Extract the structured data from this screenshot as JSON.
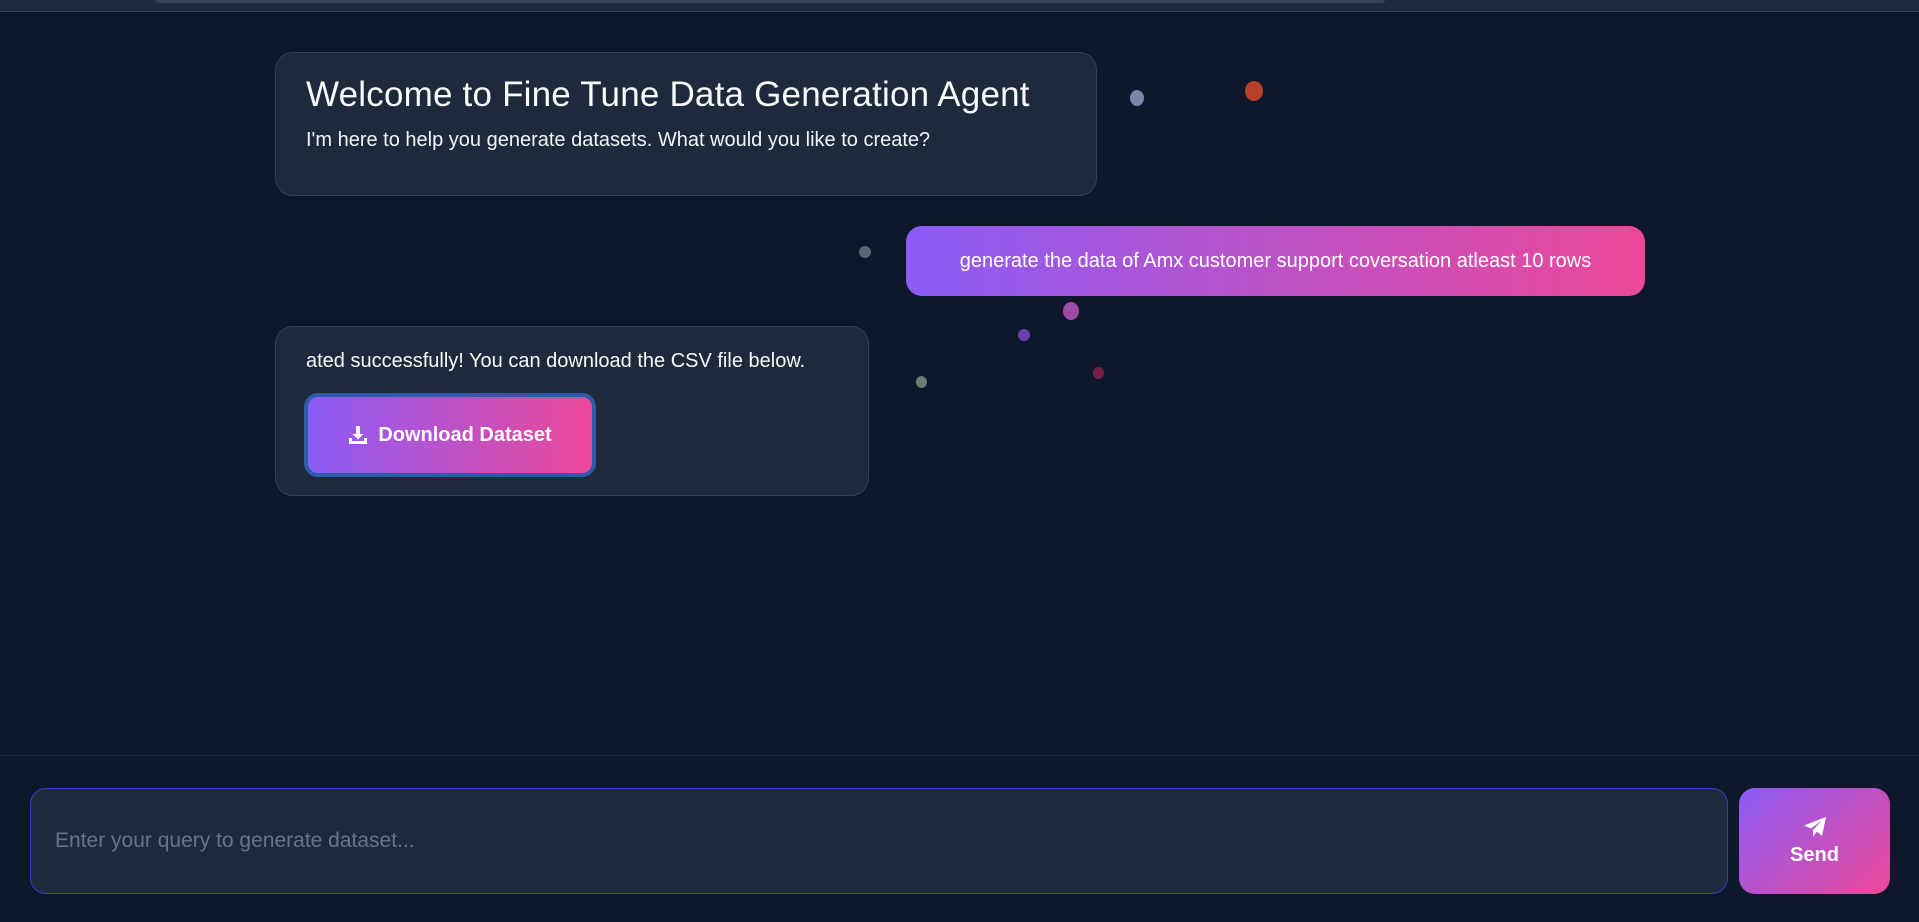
{
  "welcome": {
    "title": "Welcome to Fine Tune Data Generation Agent",
    "subtitle": "I'm here to help you generate datasets. What would you like to create?"
  },
  "messages": {
    "user_message": "generate the data of Amx customer support coversation atleast 10 rows",
    "bot_result": "ated successfully! You can download the CSV file below."
  },
  "download": {
    "label": "Download Dataset",
    "icon": "download-icon"
  },
  "composer": {
    "placeholder": "Enter your query to generate dataset...",
    "value": "",
    "send_label": "Send",
    "send_icon": "paper-plane-icon"
  },
  "colors": {
    "background": "#0f172a",
    "bubble": "#1e293b",
    "gradient_start": "#8b5cf6",
    "gradient_end": "#ec4899"
  }
}
